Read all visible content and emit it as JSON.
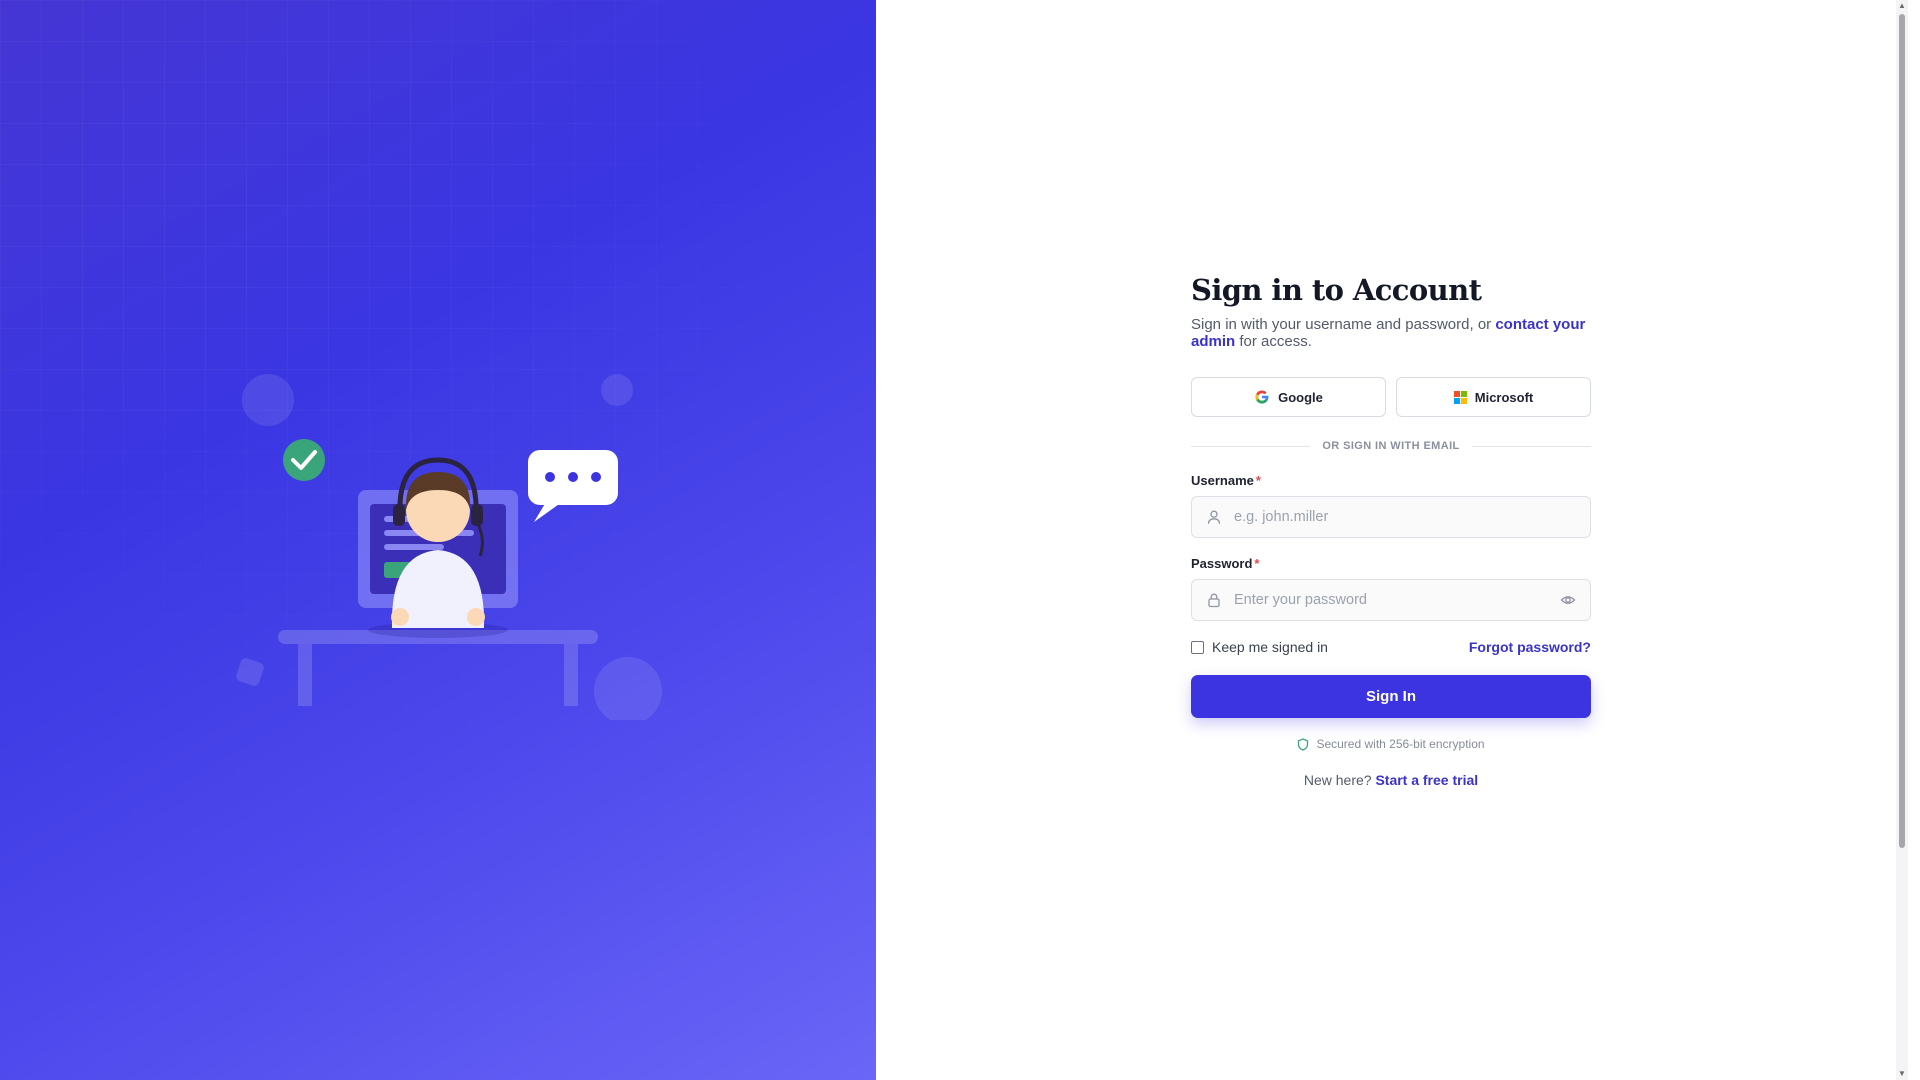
{
  "hero": {
    "chat_dots": "• • •"
  },
  "form": {
    "title": "Sign in to Account",
    "subtitle_before": "Sign in with your username and password, or ",
    "subtitle_link": "contact your admin",
    "subtitle_after": " for access.",
    "social": {
      "google_label": "Google",
      "microsoft_label": "Microsoft"
    },
    "divider_text": "OR SIGN IN WITH EMAIL",
    "username": {
      "label": "Username",
      "required_mark": "*",
      "placeholder": "e.g. john.miller",
      "icon": "user-icon"
    },
    "password": {
      "label": "Password",
      "required_mark": "*",
      "placeholder": "Enter your password",
      "icon": "lock-icon",
      "toggle_icon": "eye-icon"
    },
    "remember_label": "Keep me signed in",
    "remember_checked": false,
    "forgot_label": "Forgot password?",
    "submit_label": "Sign In",
    "secure_text": "Secured with 256-bit encryption",
    "signup_prompt": "New here?",
    "signup_link": "Start a free trial"
  },
  "colors": {
    "accent": "#3b34e0",
    "link": "#3a33c9",
    "required": "#e5484d",
    "success": "#3aa57a",
    "hero_gradient_start": "#4536d4",
    "hero_gradient_end": "#6a66f7"
  }
}
